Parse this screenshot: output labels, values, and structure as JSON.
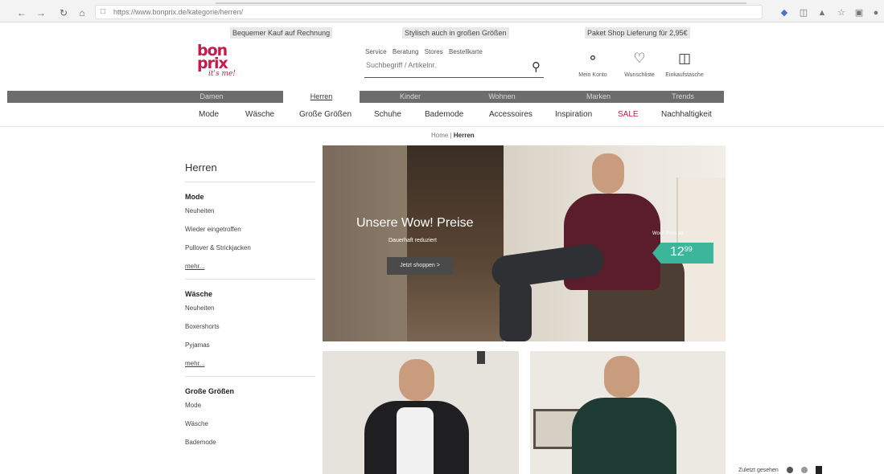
{
  "browser": {
    "url": "https://www.bonprix.de/kategorie/herren/"
  },
  "usp": {
    "left": "Bequemer Kauf auf Rechnung",
    "center": "Stylisch auch in großen Größen",
    "right": "Paket Shop Lieferung für 2,95€"
  },
  "header": {
    "logo_line1": "bon",
    "logo_line2": "prix",
    "logo_tagline": "it's me!",
    "service_links": [
      "Service",
      "Beratung",
      "Stores",
      "Bestellkarte"
    ],
    "search_placeholder": "Suchbegriff / Artikelnr.",
    "account_label": "Mein Konto",
    "wishlist_label": "Wunschliste",
    "cart_label": "Einkaufstasche"
  },
  "departments": [
    {
      "label": "Damen"
    },
    {
      "label": "Herren",
      "active": true
    },
    {
      "label": "Kinder"
    },
    {
      "label": "Wohnen"
    },
    {
      "label": "Marken"
    },
    {
      "label": "Trends"
    }
  ],
  "categories": [
    "Mode",
    "Wäsche",
    "Große Größen",
    "Schuhe",
    "Bademode",
    "Accessoires",
    "Inspiration",
    "SALE",
    "Nachhaltigkeit"
  ],
  "breadcrumb": {
    "home": "Home",
    "separator": "|",
    "current": "Herren"
  },
  "sidebar": {
    "title": "Herren",
    "groups": [
      {
        "head": "Mode",
        "items": [
          "Neuheiten",
          "Wieder eingetroffen",
          "Pullover & Strickjacken"
        ],
        "more": "mehr..."
      },
      {
        "head": "Wäsche",
        "items": [
          "Neuheiten",
          "Boxershorts",
          "Pyjamas"
        ],
        "more": "mehr..."
      },
      {
        "head": "Große Größen",
        "items": [
          "Mode",
          "Wäsche",
          "Bademode"
        ]
      }
    ]
  },
  "hero": {
    "title": "Unsere Wow! Preise",
    "subtitle": "Dauerhaft reduziert",
    "button": "Jetzt shoppen >",
    "price_note": "Wow! Preis ab",
    "price_main": "12",
    "price_cents": "99"
  },
  "recently_viewed": {
    "label": "Zuletzt gesehen"
  },
  "colors": {
    "brand": "#c51a4a",
    "dept_bar": "#6d6d6d",
    "price_tag": "#3bb69a"
  }
}
